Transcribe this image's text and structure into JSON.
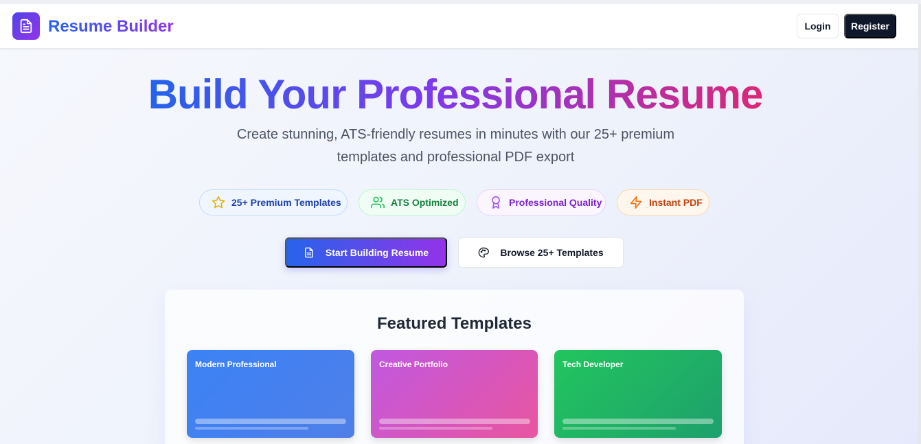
{
  "header": {
    "brand": "Resume Builder",
    "logo_icon": "document-icon",
    "login_label": "Login",
    "register_label": "Register"
  },
  "hero": {
    "title": "Build Your Professional Resume",
    "subtitle": "Create stunning, ATS-friendly resumes in minutes with our 25+ premium templates and professional PDF export",
    "title_gradient": [
      "#2563eb",
      "#7c3aed",
      "#db2777"
    ]
  },
  "features": [
    {
      "label": "25+ Premium Templates",
      "icon": "star-icon",
      "color": "#1e40af"
    },
    {
      "label": "ATS Optimized",
      "icon": "users-icon",
      "color": "#15803d"
    },
    {
      "label": "Professional Quality",
      "icon": "award-icon",
      "color": "#7e22ce"
    },
    {
      "label": "Instant PDF",
      "icon": "lightning-icon",
      "color": "#c2410c"
    }
  ],
  "actions": {
    "primary_label": "Start Building Resume",
    "primary_icon": "document-icon",
    "secondary_label": "Browse 25+ Templates",
    "secondary_icon": "palette-icon"
  },
  "featured": {
    "title": "Featured Templates",
    "templates": [
      {
        "name": "Modern Professional",
        "color": "#3b82f6"
      },
      {
        "name": "Creative Portfolio",
        "color": "#d946ef"
      },
      {
        "name": "Tech Developer",
        "color": "#22c55e"
      }
    ]
  }
}
